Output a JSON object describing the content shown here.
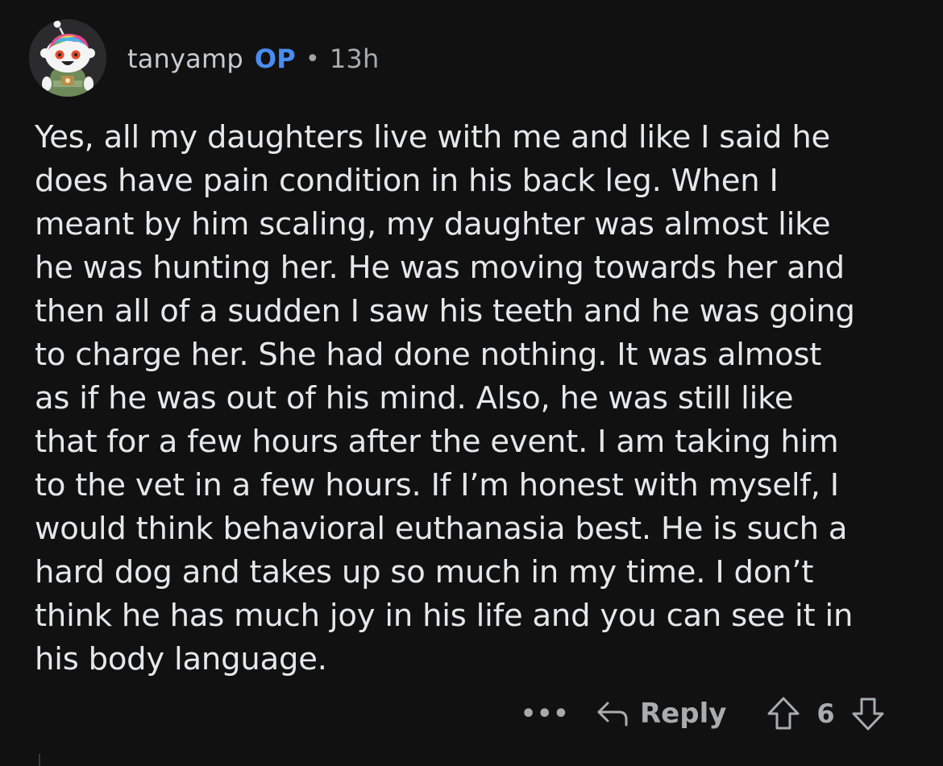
{
  "comment": {
    "author": "tanyamp",
    "op_badge": "OP",
    "separator": "•",
    "time": "13h",
    "body": "Yes, all my daughters live with me and like I said he\ndoes have pain condition in his back leg. When I\nmeant by him scaling, my daughter was almost like\nhe was hunting her. He was moving towards her and\nthen all of a sudden I saw his teeth and he was going\nto charge her. She had done nothing. It was almost\nas if he was out of his mind. Also, he was still like\nthat for a few hours after the event. I am taking him\nto the vet in a few hours. If I’m honest with myself, I\nwould think behavioral euthanasia best. He is such a\nhard dog and takes up so much in my time. I don’t\nthink he has much joy in his life and you can see it in\nhis body language."
  },
  "actions": {
    "more_label": "•••",
    "reply_label": "Reply",
    "score": "6",
    "icons": [
      "more-icon",
      "reply-arrow-icon",
      "upvote-icon",
      "downvote-icon"
    ]
  },
  "colors": {
    "background": "#111112",
    "op_badge": "#4a8cf0",
    "text": "#e6e7e8",
    "muted": "#a9acae"
  }
}
